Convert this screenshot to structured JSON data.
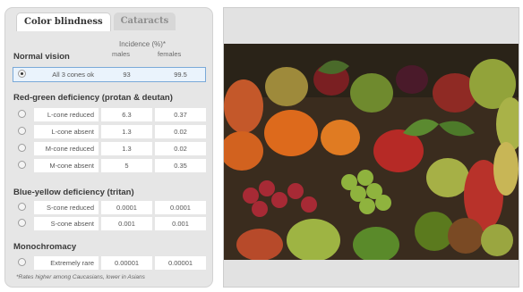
{
  "tabs": [
    {
      "label": "Color blindness",
      "active": true
    },
    {
      "label": "Cataracts",
      "active": false
    }
  ],
  "header": {
    "normal_vision": "Normal vision",
    "incidence": "Incidence (%)*",
    "males": "males",
    "females": "females"
  },
  "rows": {
    "normal": {
      "label": "All 3 cones ok",
      "males": "93",
      "females": "99.5",
      "selected": true
    },
    "rg_title": "Red-green deficiency (protan & deutan)",
    "l_reduced": {
      "label": "L-cone reduced",
      "males": "6.3",
      "females": "0.37"
    },
    "l_absent": {
      "label": "L-cone absent",
      "males": "1.3",
      "females": "0.02"
    },
    "m_reduced": {
      "label": "M-cone reduced",
      "males": "1.3",
      "females": "0.02"
    },
    "m_absent": {
      "label": "M-cone absent",
      "males": "5",
      "females": "0.35"
    },
    "by_title": "Blue-yellow deficiency (tritan)",
    "s_reduced": {
      "label": "S-cone reduced",
      "males": "0.0001",
      "females": "0.0001"
    },
    "s_absent": {
      "label": "S-cone absent",
      "males": "0.001",
      "females": "0.001"
    },
    "mono_title": "Monochromacy",
    "extreme": {
      "label": "Extremely rare",
      "males": "0.00001",
      "females": "0.00001"
    }
  },
  "footnote": "*Rates higher among Caucasians, lower in Asians",
  "colors": {
    "selection": "#7aa9d8",
    "panel": "#e6e6e6"
  }
}
